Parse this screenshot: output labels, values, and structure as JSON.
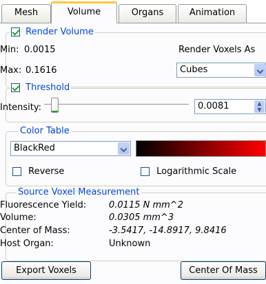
{
  "tabs": [
    {
      "label": "Mesh"
    },
    {
      "label": "Volume"
    },
    {
      "label": "Organs"
    },
    {
      "label": "Animation"
    }
  ],
  "render_volume": {
    "legend": "Render Volume",
    "checked": true,
    "min_label": "Min:",
    "min_value": "0.0015",
    "max_label": "Max:",
    "max_value": "0.1616",
    "voxels_as_label": "Render Voxels As",
    "voxels_as_value": "Cubes"
  },
  "threshold": {
    "legend": "Threshold",
    "checked": true,
    "intensity_label": "Intensity:",
    "intensity_value": "0.0081",
    "slider_fraction": 0.05
  },
  "color_table": {
    "legend": "Color Table",
    "selected": "BlackRed",
    "gradient_colors": [
      "#000000",
      "#ff0000"
    ],
    "reverse_label": "Reverse",
    "reverse_checked": false,
    "log_label": "Logarithmic Scale",
    "log_checked": false
  },
  "source": {
    "legend": "Source Voxel Measurement",
    "fluorescence_label": "Fluorescence Yield:",
    "fluorescence_value": "0.0115 N mm^2",
    "volume_label": "Volume:",
    "volume_value": "0.0305 mm^3",
    "com_label": "Center of Mass:",
    "com_value": "-3.5417, -14.8917, 9.8416",
    "host_label": "Host Organ:",
    "host_value": "Unknown"
  },
  "buttons": {
    "export": "Export Voxels",
    "center": "Center Of Mass"
  },
  "colors": {
    "legend_blue": "#0046d5",
    "active_tab_accent": "#ffc83c",
    "check_green": "#21a121"
  }
}
